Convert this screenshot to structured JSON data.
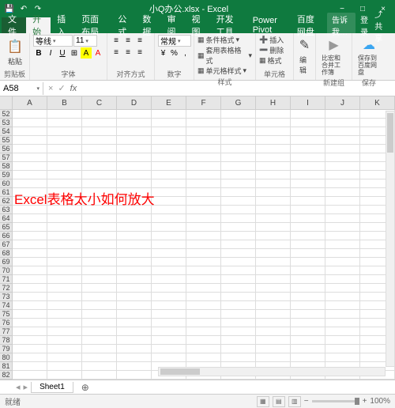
{
  "title_bar": {
    "filename": "小Q办公.xlsx - Excel",
    "save_icon": "💾",
    "undo_icon": "↶",
    "redo_icon": "↷"
  },
  "ribbon_tabs": {
    "file": "文件",
    "home": "开始",
    "insert": "插入",
    "layout": "页面布局",
    "formulas": "公式",
    "data": "数据",
    "review": "审阅",
    "view": "视图",
    "dev": "开发工具",
    "powerpivot": "Power Pivot",
    "baidu": "百度网盘",
    "tell_me": "告诉我…",
    "login": "登录",
    "share": "共享"
  },
  "ribbon": {
    "clipboard": {
      "label": "剪贴板",
      "paste": "粘贴"
    },
    "font": {
      "label": "字体",
      "name": "等线",
      "size": "11"
    },
    "align": {
      "label": "对齐方式"
    },
    "number": {
      "label": "数字",
      "format": "常规"
    },
    "styles": {
      "label": "样式",
      "cond": "条件格式",
      "table": "套用表格格式",
      "cell": "单元格样式"
    },
    "cells": {
      "label": "单元格",
      "insert": "插入",
      "delete": "删除",
      "format": "格式"
    },
    "editing": {
      "label": "编辑"
    },
    "record": {
      "label": "新建组",
      "macro": "比宏和合并工作簿"
    },
    "save": {
      "label": "保存",
      "baidu": "保存到百度网盘"
    }
  },
  "formula_bar": {
    "cell_ref": "A58",
    "fx": "fx"
  },
  "grid": {
    "columns": [
      "A",
      "B",
      "C",
      "D",
      "E",
      "F",
      "G",
      "H",
      "I",
      "J",
      "K"
    ],
    "row_start": 52,
    "row_end": 82,
    "overlay_text": "Excel表格太小如何放大"
  },
  "sheet_tabs": {
    "sheet1": "Sheet1",
    "add": "⊕"
  },
  "status_bar": {
    "ready": "就绪",
    "zoom": "100%",
    "minus": "−",
    "plus": "+"
  }
}
